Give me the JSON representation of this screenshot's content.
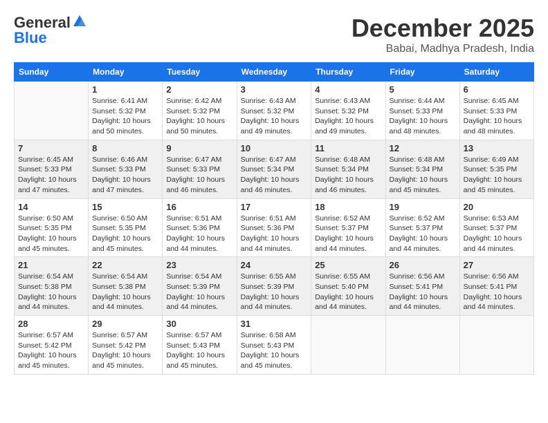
{
  "logo": {
    "general": "General",
    "blue": "Blue"
  },
  "title": "December 2025",
  "location": "Babai, Madhya Pradesh, India",
  "days_of_week": [
    "Sunday",
    "Monday",
    "Tuesday",
    "Wednesday",
    "Thursday",
    "Friday",
    "Saturday"
  ],
  "weeks": [
    [
      {
        "day": "",
        "info": ""
      },
      {
        "day": "1",
        "info": "Sunrise: 6:41 AM\nSunset: 5:32 PM\nDaylight: 10 hours\nand 50 minutes."
      },
      {
        "day": "2",
        "info": "Sunrise: 6:42 AM\nSunset: 5:32 PM\nDaylight: 10 hours\nand 50 minutes."
      },
      {
        "day": "3",
        "info": "Sunrise: 6:43 AM\nSunset: 5:32 PM\nDaylight: 10 hours\nand 49 minutes."
      },
      {
        "day": "4",
        "info": "Sunrise: 6:43 AM\nSunset: 5:32 PM\nDaylight: 10 hours\nand 49 minutes."
      },
      {
        "day": "5",
        "info": "Sunrise: 6:44 AM\nSunset: 5:33 PM\nDaylight: 10 hours\nand 48 minutes."
      },
      {
        "day": "6",
        "info": "Sunrise: 6:45 AM\nSunset: 5:33 PM\nDaylight: 10 hours\nand 48 minutes."
      }
    ],
    [
      {
        "day": "7",
        "info": "Sunrise: 6:45 AM\nSunset: 5:33 PM\nDaylight: 10 hours\nand 47 minutes."
      },
      {
        "day": "8",
        "info": "Sunrise: 6:46 AM\nSunset: 5:33 PM\nDaylight: 10 hours\nand 47 minutes."
      },
      {
        "day": "9",
        "info": "Sunrise: 6:47 AM\nSunset: 5:33 PM\nDaylight: 10 hours\nand 46 minutes."
      },
      {
        "day": "10",
        "info": "Sunrise: 6:47 AM\nSunset: 5:34 PM\nDaylight: 10 hours\nand 46 minutes."
      },
      {
        "day": "11",
        "info": "Sunrise: 6:48 AM\nSunset: 5:34 PM\nDaylight: 10 hours\nand 46 minutes."
      },
      {
        "day": "12",
        "info": "Sunrise: 6:48 AM\nSunset: 5:34 PM\nDaylight: 10 hours\nand 45 minutes."
      },
      {
        "day": "13",
        "info": "Sunrise: 6:49 AM\nSunset: 5:35 PM\nDaylight: 10 hours\nand 45 minutes."
      }
    ],
    [
      {
        "day": "14",
        "info": "Sunrise: 6:50 AM\nSunset: 5:35 PM\nDaylight: 10 hours\nand 45 minutes."
      },
      {
        "day": "15",
        "info": "Sunrise: 6:50 AM\nSunset: 5:35 PM\nDaylight: 10 hours\nand 45 minutes."
      },
      {
        "day": "16",
        "info": "Sunrise: 6:51 AM\nSunset: 5:36 PM\nDaylight: 10 hours\nand 44 minutes."
      },
      {
        "day": "17",
        "info": "Sunrise: 6:51 AM\nSunset: 5:36 PM\nDaylight: 10 hours\nand 44 minutes."
      },
      {
        "day": "18",
        "info": "Sunrise: 6:52 AM\nSunset: 5:37 PM\nDaylight: 10 hours\nand 44 minutes."
      },
      {
        "day": "19",
        "info": "Sunrise: 6:52 AM\nSunset: 5:37 PM\nDaylight: 10 hours\nand 44 minutes."
      },
      {
        "day": "20",
        "info": "Sunrise: 6:53 AM\nSunset: 5:37 PM\nDaylight: 10 hours\nand 44 minutes."
      }
    ],
    [
      {
        "day": "21",
        "info": "Sunrise: 6:54 AM\nSunset: 5:38 PM\nDaylight: 10 hours\nand 44 minutes."
      },
      {
        "day": "22",
        "info": "Sunrise: 6:54 AM\nSunset: 5:38 PM\nDaylight: 10 hours\nand 44 minutes."
      },
      {
        "day": "23",
        "info": "Sunrise: 6:54 AM\nSunset: 5:39 PM\nDaylight: 10 hours\nand 44 minutes."
      },
      {
        "day": "24",
        "info": "Sunrise: 6:55 AM\nSunset: 5:39 PM\nDaylight: 10 hours\nand 44 minutes."
      },
      {
        "day": "25",
        "info": "Sunrise: 6:55 AM\nSunset: 5:40 PM\nDaylight: 10 hours\nand 44 minutes."
      },
      {
        "day": "26",
        "info": "Sunrise: 6:56 AM\nSunset: 5:41 PM\nDaylight: 10 hours\nand 44 minutes."
      },
      {
        "day": "27",
        "info": "Sunrise: 6:56 AM\nSunset: 5:41 PM\nDaylight: 10 hours\nand 44 minutes."
      }
    ],
    [
      {
        "day": "28",
        "info": "Sunrise: 6:57 AM\nSunset: 5:42 PM\nDaylight: 10 hours\nand 45 minutes."
      },
      {
        "day": "29",
        "info": "Sunrise: 6:57 AM\nSunset: 5:42 PM\nDaylight: 10 hours\nand 45 minutes."
      },
      {
        "day": "30",
        "info": "Sunrise: 6:57 AM\nSunset: 5:43 PM\nDaylight: 10 hours\nand 45 minutes."
      },
      {
        "day": "31",
        "info": "Sunrise: 6:58 AM\nSunset: 5:43 PM\nDaylight: 10 hours\nand 45 minutes."
      },
      {
        "day": "",
        "info": ""
      },
      {
        "day": "",
        "info": ""
      },
      {
        "day": "",
        "info": ""
      }
    ]
  ]
}
